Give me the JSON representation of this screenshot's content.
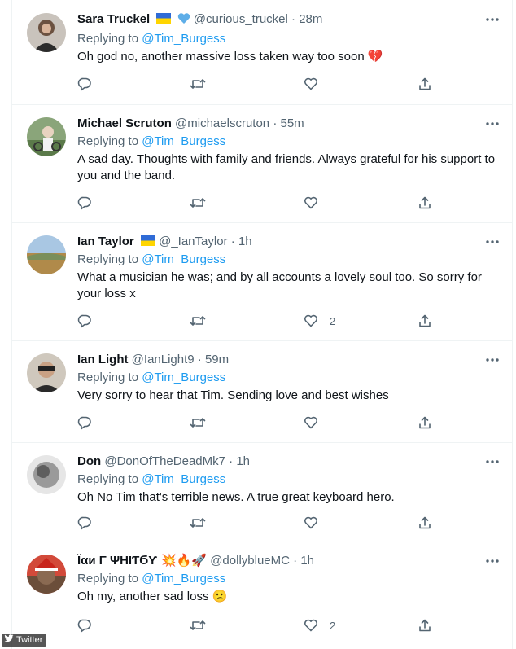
{
  "tweets": [
    {
      "name": "Sara Truckel",
      "handle": "@curious_truckel",
      "sep": "·",
      "time": "28m",
      "replying_prefix": "Replying to",
      "replying_to": "@Tim_Burgess",
      "text": "Oh god no, another massive loss taken way too soon 💔",
      "likes": "",
      "flags": [
        "ukraine-flag",
        "blue-heart"
      ]
    },
    {
      "name": "Michael Scruton",
      "handle": "@michaelscruton",
      "sep": "·",
      "time": "55m",
      "replying_prefix": "Replying to",
      "replying_to": "@Tim_Burgess",
      "text": "A sad day. Thoughts with family and friends. Always grateful for his support to you and the band.",
      "likes": ""
    },
    {
      "name": "Ian Taylor",
      "handle": "@_IanTaylor",
      "sep": "·",
      "time": "1h",
      "replying_prefix": "Replying to",
      "replying_to": "@Tim_Burgess",
      "text": "What a musician he was; and by all accounts a lovely soul too. So sorry for your loss x",
      "likes": "2",
      "flags": [
        "ukraine-flag"
      ]
    },
    {
      "name": "Ian Light",
      "handle": "@IanLight9",
      "sep": "·",
      "time": "59m",
      "replying_prefix": "Replying to",
      "replying_to": "@Tim_Burgess",
      "text": "Very sorry to hear that Tim. Sending love and best wishes",
      "likes": ""
    },
    {
      "name": "Don",
      "handle": "@DonOfTheDeadMk7",
      "sep": "·",
      "time": "1h",
      "replying_prefix": "Replying to",
      "replying_to": "@Tim_Burgess",
      "text": "Oh No Tim that's terrible news. A true great keyboard hero.",
      "likes": ""
    },
    {
      "name": "Ïαи Γ ΨΗΙƬϬƳ 💥🔥🚀",
      "handle": "@dollyblueMC",
      "sep": "·",
      "time": "1h",
      "replying_prefix": "Replying to",
      "replying_to": "@Tim_Burgess",
      "text": "Oh my, another sad loss 😕",
      "likes": "2"
    }
  ],
  "watermark": "Twitter",
  "colors": {
    "link": "#1d9bf0",
    "muted": "#536471",
    "text": "#0f1419",
    "divider": "#eff3f4"
  }
}
